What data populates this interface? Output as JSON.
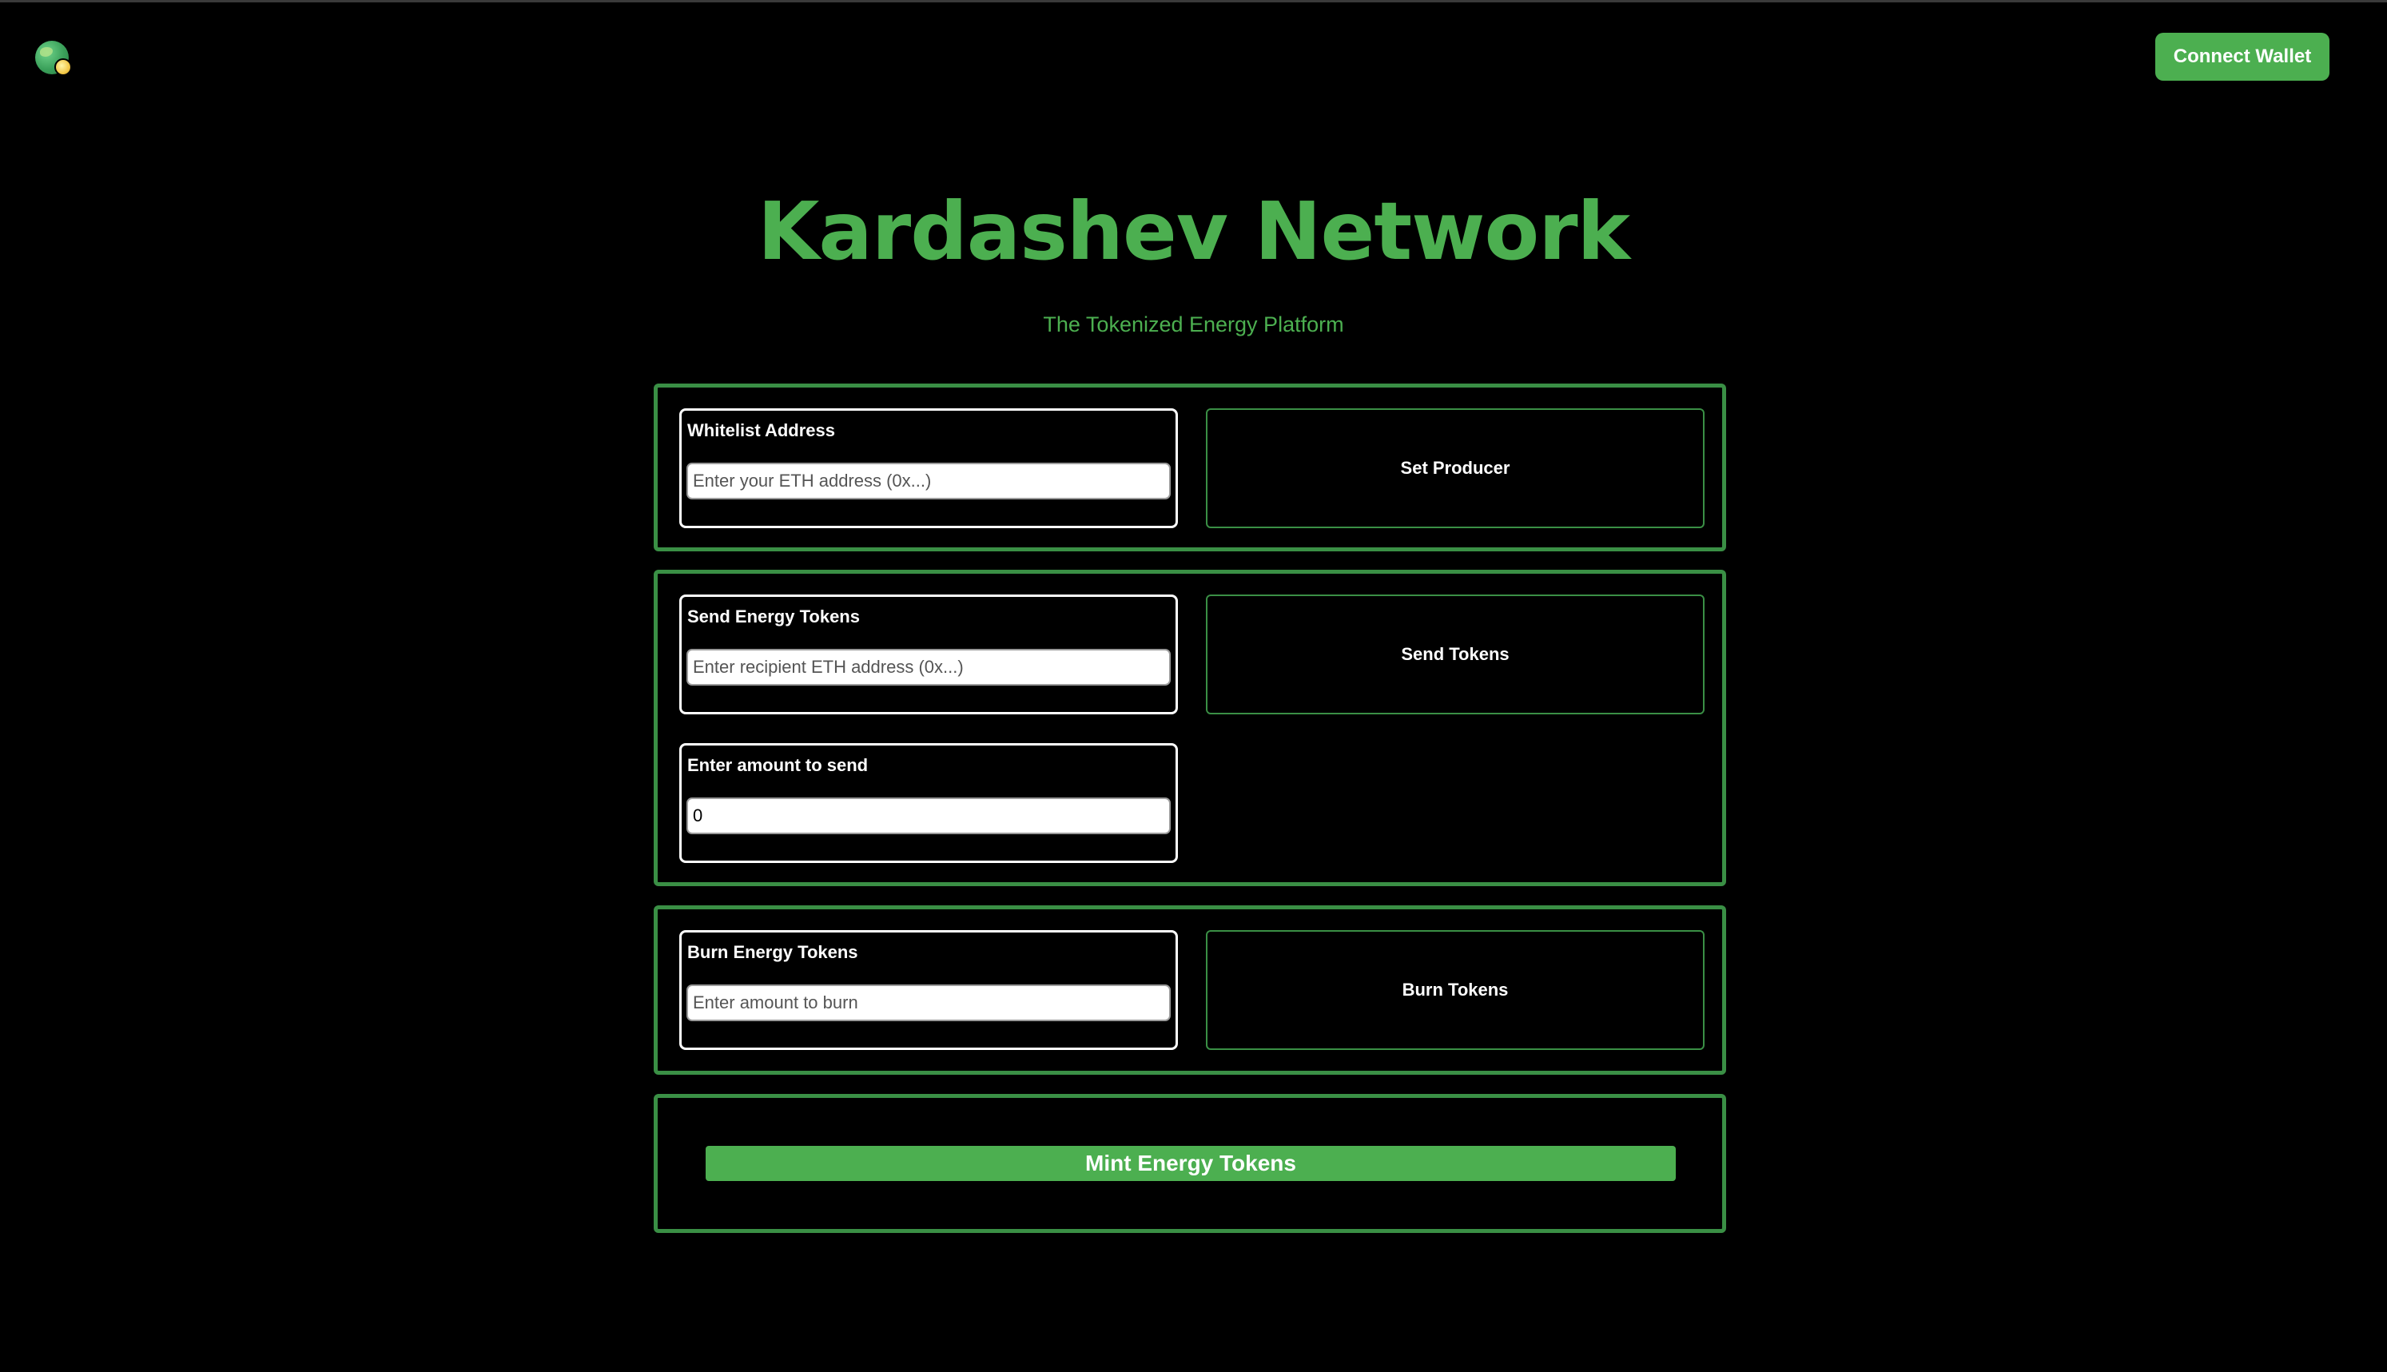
{
  "header": {
    "logo_icon": "globe-icon",
    "connect_wallet_label": "Connect Wallet"
  },
  "hero": {
    "title": "Kardashev Network",
    "subtitle": "The Tokenized Energy Platform"
  },
  "whitelist": {
    "label": "Whitelist Address",
    "placeholder": "Enter your ETH address (0x...)",
    "value": "",
    "button_label": "Set Producer"
  },
  "send": {
    "label": "Send Energy Tokens",
    "address_placeholder": "Enter recipient ETH address (0x...)",
    "address_value": "",
    "amount_label": "Enter amount to send",
    "amount_value": "0",
    "button_label": "Send Tokens"
  },
  "burn": {
    "label": "Burn Energy Tokens",
    "placeholder": "Enter amount to burn",
    "value": "",
    "button_label": "Burn Tokens"
  },
  "mint": {
    "button_label": "Mint Energy Tokens"
  },
  "colors": {
    "background": "#000000",
    "accent": "#4caf50",
    "panel_border": "#3a8f45",
    "text": "#ffffff"
  }
}
